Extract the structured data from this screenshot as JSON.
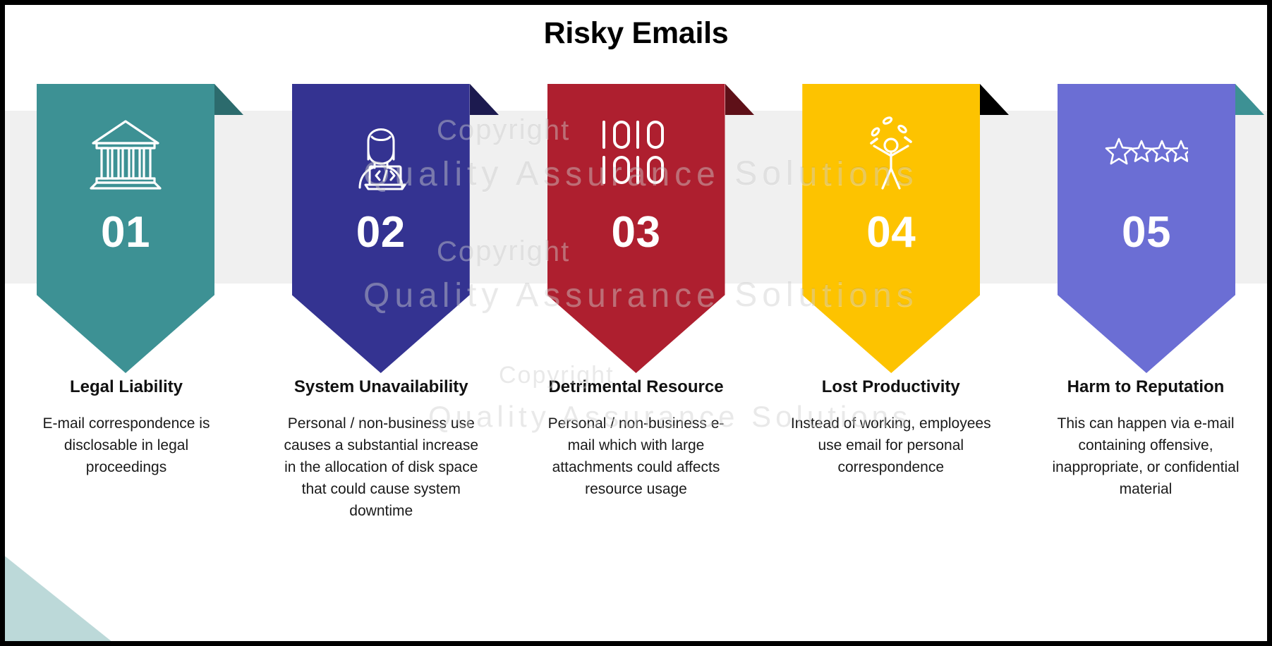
{
  "slide": {
    "title": "Risky Emails",
    "watermark_lines": [
      "Copyright",
      "Quality Assurance Solutions",
      "Copyright",
      "Quality Assurance Solutions",
      "Copyright",
      "Quality Assurance Solutions"
    ],
    "band_color": "#f0f0f0",
    "corner_color": "#bcd9d9",
    "border_color": "#000000"
  },
  "cards": [
    {
      "number": "01",
      "color": "#3d9194",
      "fold_color": "#2c6b6d",
      "icon": "bank-building-icon",
      "heading": "Legal Liability",
      "body": "E-mail correspondence is disclosable in legal proceedings"
    },
    {
      "number": "02",
      "color": "#343391",
      "fold_color": "#1c1a4f",
      "icon": "woman-developer-laptop-icon",
      "heading": "System Unavailability",
      "body": "Personal / non-business use causes a substantial increase in the allocation of disk space that could cause system downtime"
    },
    {
      "number": "03",
      "color": "#ae1f2f",
      "fold_color": "#5e1018",
      "icon": "binary-code-icon",
      "heading": "Detrimental Resource",
      "body": "Personal / non-business e-mail which with large attachments could affects resource usage"
    },
    {
      "number": "04",
      "color": "#fdc300",
      "fold_color": "#000000",
      "icon": "juggling-person-icon",
      "heading": "Lost Productivity",
      "body": "Instead of working, employees use email for personal correspondence"
    },
    {
      "number": "05",
      "color": "#6b6ed4",
      "fold_color": "#3d9194",
      "icon": "star-rating-icon",
      "heading": "Harm to Reputation",
      "body": "This can happen via e-mail containing offensive, inappropriate, or confidential material"
    }
  ]
}
